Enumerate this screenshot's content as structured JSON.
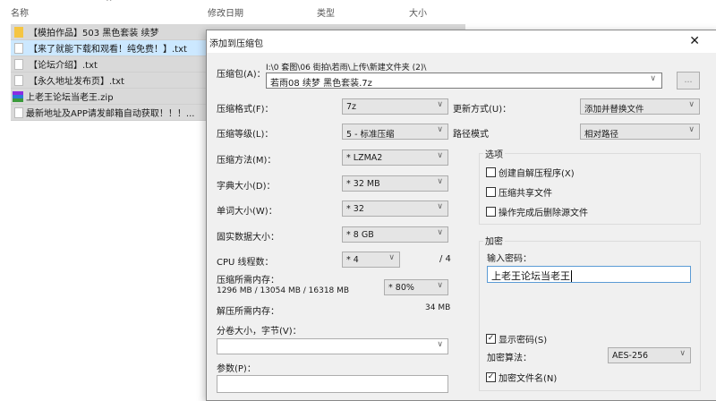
{
  "explorer": {
    "columns": [
      "名称",
      "修改日期",
      "类型",
      "大小"
    ],
    "files": [
      {
        "name": "【模拍作品】503 黑色套装 续梦",
        "icon": "folder-icon"
      },
      {
        "name": "【来了就能下载和观看！纯免费！】.txt",
        "icon": "text-file-icon"
      },
      {
        "name": "【论坛介绍】.txt",
        "icon": "text-file-icon"
      },
      {
        "name": "【永久地址发布页】.txt",
        "icon": "text-file-icon"
      },
      {
        "name": "上老王论坛当老王.zip",
        "icon": "winrar-archive-icon"
      },
      {
        "name": "最新地址及APP请发邮箱自动获取！！！...",
        "icon": "text-file-icon"
      }
    ]
  },
  "dialog": {
    "title": "添加到压缩包",
    "close": "✕",
    "archive_label": "压缩包(A)：",
    "archive_path": "I:\\0 套图\\06 街拍\\若雨\\上传\\新建文件夹 (2)\\",
    "archive_name": "若雨08 续梦 黑色套装.7z",
    "browse": "...",
    "left": [
      {
        "label": "压缩格式(F)：",
        "value": "7z"
      },
      {
        "label": "压缩等级(L)：",
        "value": "5 - 标准压缩"
      },
      {
        "label": "压缩方法(M)：",
        "value": "* LZMA2"
      },
      {
        "label": "字典大小(D)：",
        "value": "* 32 MB"
      },
      {
        "label": "单词大小(W)：",
        "value": "* 32"
      },
      {
        "label": "固实数据大小：",
        "value": "* 8 GB"
      }
    ],
    "cpu_label": "CPU 线程数：",
    "cpu_value": "* 4",
    "cpu_max": "/ 4",
    "mem_label": "压缩所需内存：",
    "mem_values": "1296 MB / 13054 MB / 16318 MB",
    "mem_pct": "* 80%",
    "decomp_label": "解压所需内存：",
    "decomp_value": "34 MB",
    "split_label": "分卷大小，字节(V)：",
    "split_value": "",
    "params_label": "参数(P)：",
    "params_value": "",
    "update_label": "更新方式(U)：",
    "update_value": "添加并替换文件",
    "path_label": "路径模式",
    "path_value": "相对路径",
    "options_title": "选项",
    "options": [
      {
        "label": "创建自解压程序(X)",
        "checked": false
      },
      {
        "label": "压缩共享文件",
        "checked": false
      },
      {
        "label": "操作完成后删除源文件",
        "checked": false
      }
    ],
    "enc_title": "加密",
    "pwd_label": "输入密码：",
    "pwd_value": "上老王论坛当老王",
    "show_pwd": {
      "label": "显示密码(S)",
      "checked": true
    },
    "algo_label": "加密算法：",
    "algo_value": "AES-256",
    "enc_names": {
      "label": "加密文件名(N)",
      "checked": true
    }
  }
}
